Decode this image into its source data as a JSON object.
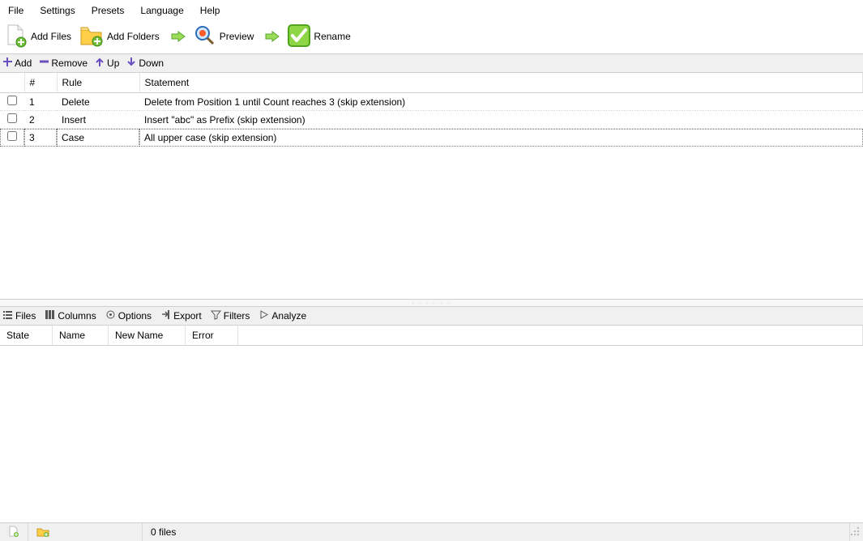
{
  "menu": [
    "File",
    "Settings",
    "Presets",
    "Language",
    "Help"
  ],
  "toolbar": {
    "add_files": "Add Files",
    "add_folders": "Add Folders",
    "preview": "Preview",
    "rename": "Rename"
  },
  "rules_bar": {
    "add": "Add",
    "remove": "Remove",
    "up": "Up",
    "down": "Down"
  },
  "rules_headers": {
    "num": "#",
    "rule": "Rule",
    "stmt": "Statement"
  },
  "rules": [
    {
      "checked": false,
      "n": "1",
      "rule": "Delete",
      "stmt": "Delete from Position 1 until Count reaches 3 (skip extension)",
      "selected": false
    },
    {
      "checked": false,
      "n": "2",
      "rule": "Insert",
      "stmt": "Insert \"abc\" as Prefix (skip extension)",
      "selected": false
    },
    {
      "checked": false,
      "n": "3",
      "rule": "Case",
      "stmt": "All upper case (skip extension)",
      "selected": true
    }
  ],
  "files_bar": {
    "files": "Files",
    "columns": "Columns",
    "options": "Options",
    "export": "Export",
    "filters": "Filters",
    "analyze": "Analyze"
  },
  "files_headers": {
    "state": "State",
    "name": "Name",
    "newname": "New Name",
    "error": "Error"
  },
  "status": {
    "file_count": "0 files"
  }
}
